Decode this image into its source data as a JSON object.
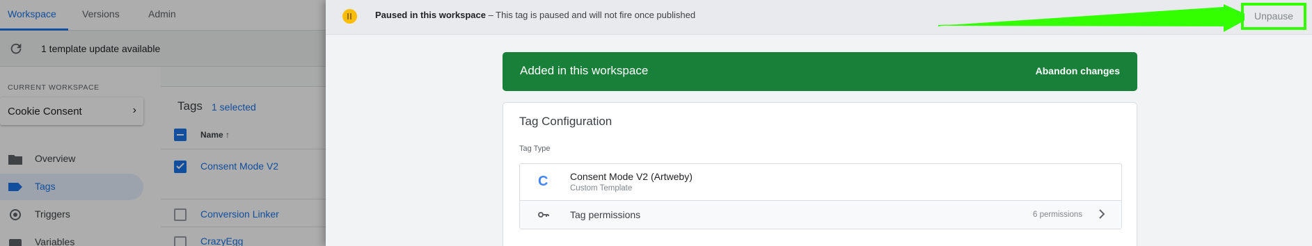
{
  "tabs": [
    {
      "label": "Workspace",
      "active": true
    },
    {
      "label": "Versions",
      "active": false
    },
    {
      "label": "Admin",
      "active": false
    }
  ],
  "update_bar": {
    "text": "1 template update available",
    "icon": "refresh-icon"
  },
  "workspace": {
    "label": "CURRENT WORKSPACE",
    "name": "Cookie Consent"
  },
  "nav": [
    {
      "label": "Overview",
      "icon": "folder-icon",
      "active": false
    },
    {
      "label": "Tags",
      "icon": "tag-icon",
      "active": true
    },
    {
      "label": "Triggers",
      "icon": "trigger-icon",
      "active": false
    },
    {
      "label": "Variables",
      "icon": "variables-icon",
      "active": false
    }
  ],
  "tags_list": {
    "title": "Tags",
    "selected": "1 selected",
    "column_name": "Name",
    "rows": [
      {
        "name": "Consent Mode V2",
        "checked": true
      },
      {
        "name": "Conversion Linker",
        "checked": false
      },
      {
        "name": "CrazyEgg",
        "checked": false
      }
    ]
  },
  "paused_bar": {
    "title": "Paused in this workspace",
    "separator": " – ",
    "message": "This tag is paused and will not fire once published",
    "unpause_label": "Unpause",
    "highlight_color": "#33ff00"
  },
  "banner": {
    "title": "Added in this workspace",
    "action": "Abandon changes",
    "color": "#188038"
  },
  "config": {
    "title": "Tag Configuration",
    "tag_type_label": "Tag Type",
    "template_icon": "C",
    "template_name": "Consent Mode V2 (Artweby)",
    "template_sub": "Custom Template",
    "permissions_label": "Tag permissions",
    "permissions_count": "6 permissions"
  }
}
